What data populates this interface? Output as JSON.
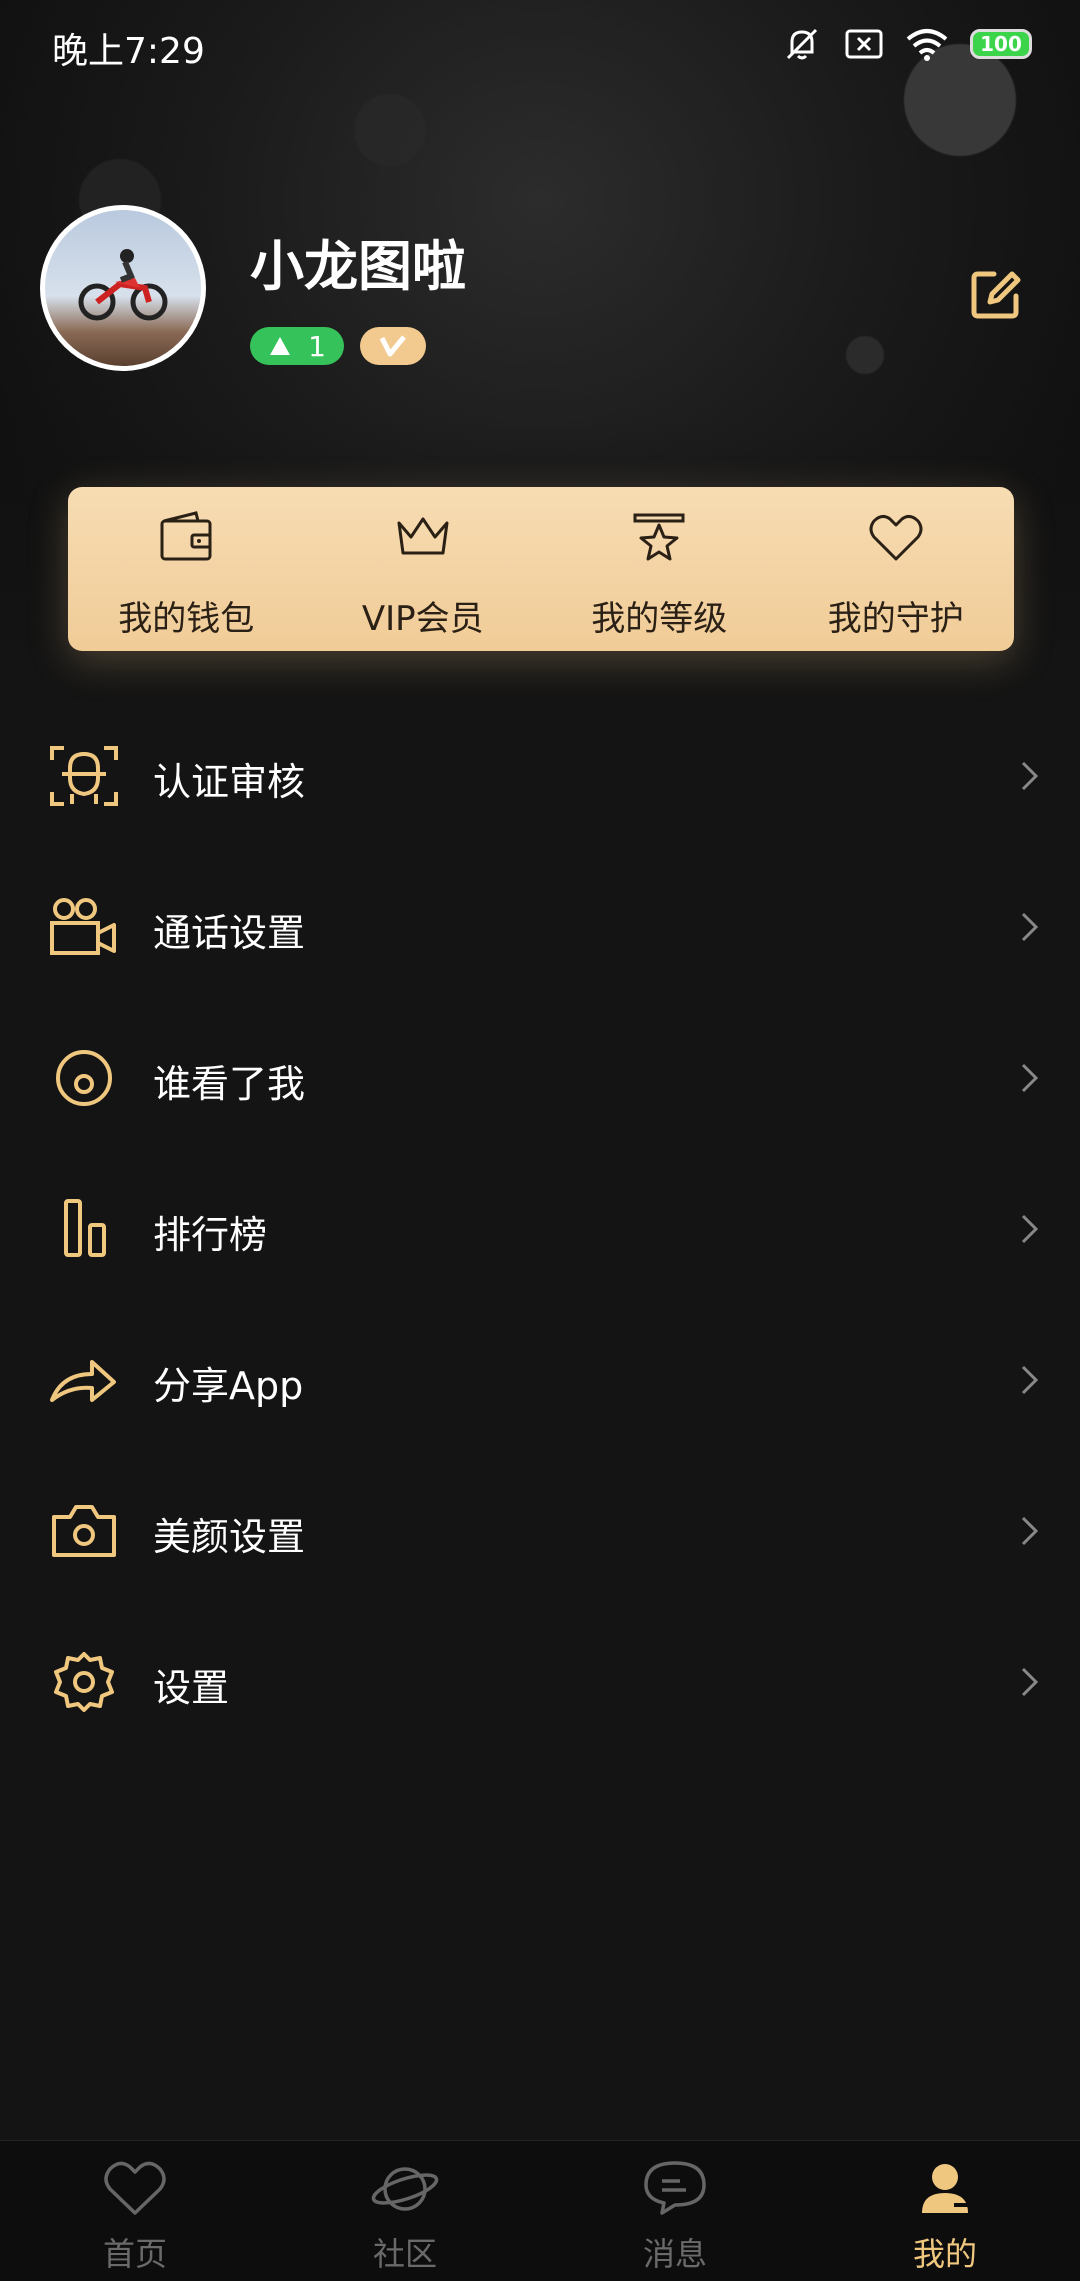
{
  "status_bar": {
    "time": "晚上7:29",
    "battery": "100"
  },
  "profile": {
    "username": "小龙图啦",
    "level": "1"
  },
  "quick_actions": [
    {
      "label": "我的钱包",
      "icon": "wallet-icon"
    },
    {
      "label": "VIP会员",
      "icon": "crown-icon"
    },
    {
      "label": "我的等级",
      "icon": "star-ribbon-icon"
    },
    {
      "label": "我的守护",
      "icon": "heart-icon"
    }
  ],
  "menu": [
    {
      "label": "认证审核",
      "icon": "face-verify-icon"
    },
    {
      "label": "通话设置",
      "icon": "video-call-icon"
    },
    {
      "label": "谁看了我",
      "icon": "visitor-icon"
    },
    {
      "label": "排行榜",
      "icon": "ranking-icon"
    },
    {
      "label": "分享App",
      "icon": "share-icon"
    },
    {
      "label": "美颜设置",
      "icon": "camera-icon"
    },
    {
      "label": "设置",
      "icon": "gear-icon"
    }
  ],
  "tabs": [
    {
      "label": "首页",
      "icon": "heart-icon",
      "active": false
    },
    {
      "label": "社区",
      "icon": "planet-icon",
      "active": false
    },
    {
      "label": "消息",
      "icon": "chat-icon",
      "active": false
    },
    {
      "label": "我的",
      "icon": "user-icon",
      "active": true
    }
  ],
  "colors": {
    "accent": "#f0c77f",
    "gold_panel": "#f3d3a2",
    "background": "#141414",
    "level_green": "#36c25a"
  }
}
